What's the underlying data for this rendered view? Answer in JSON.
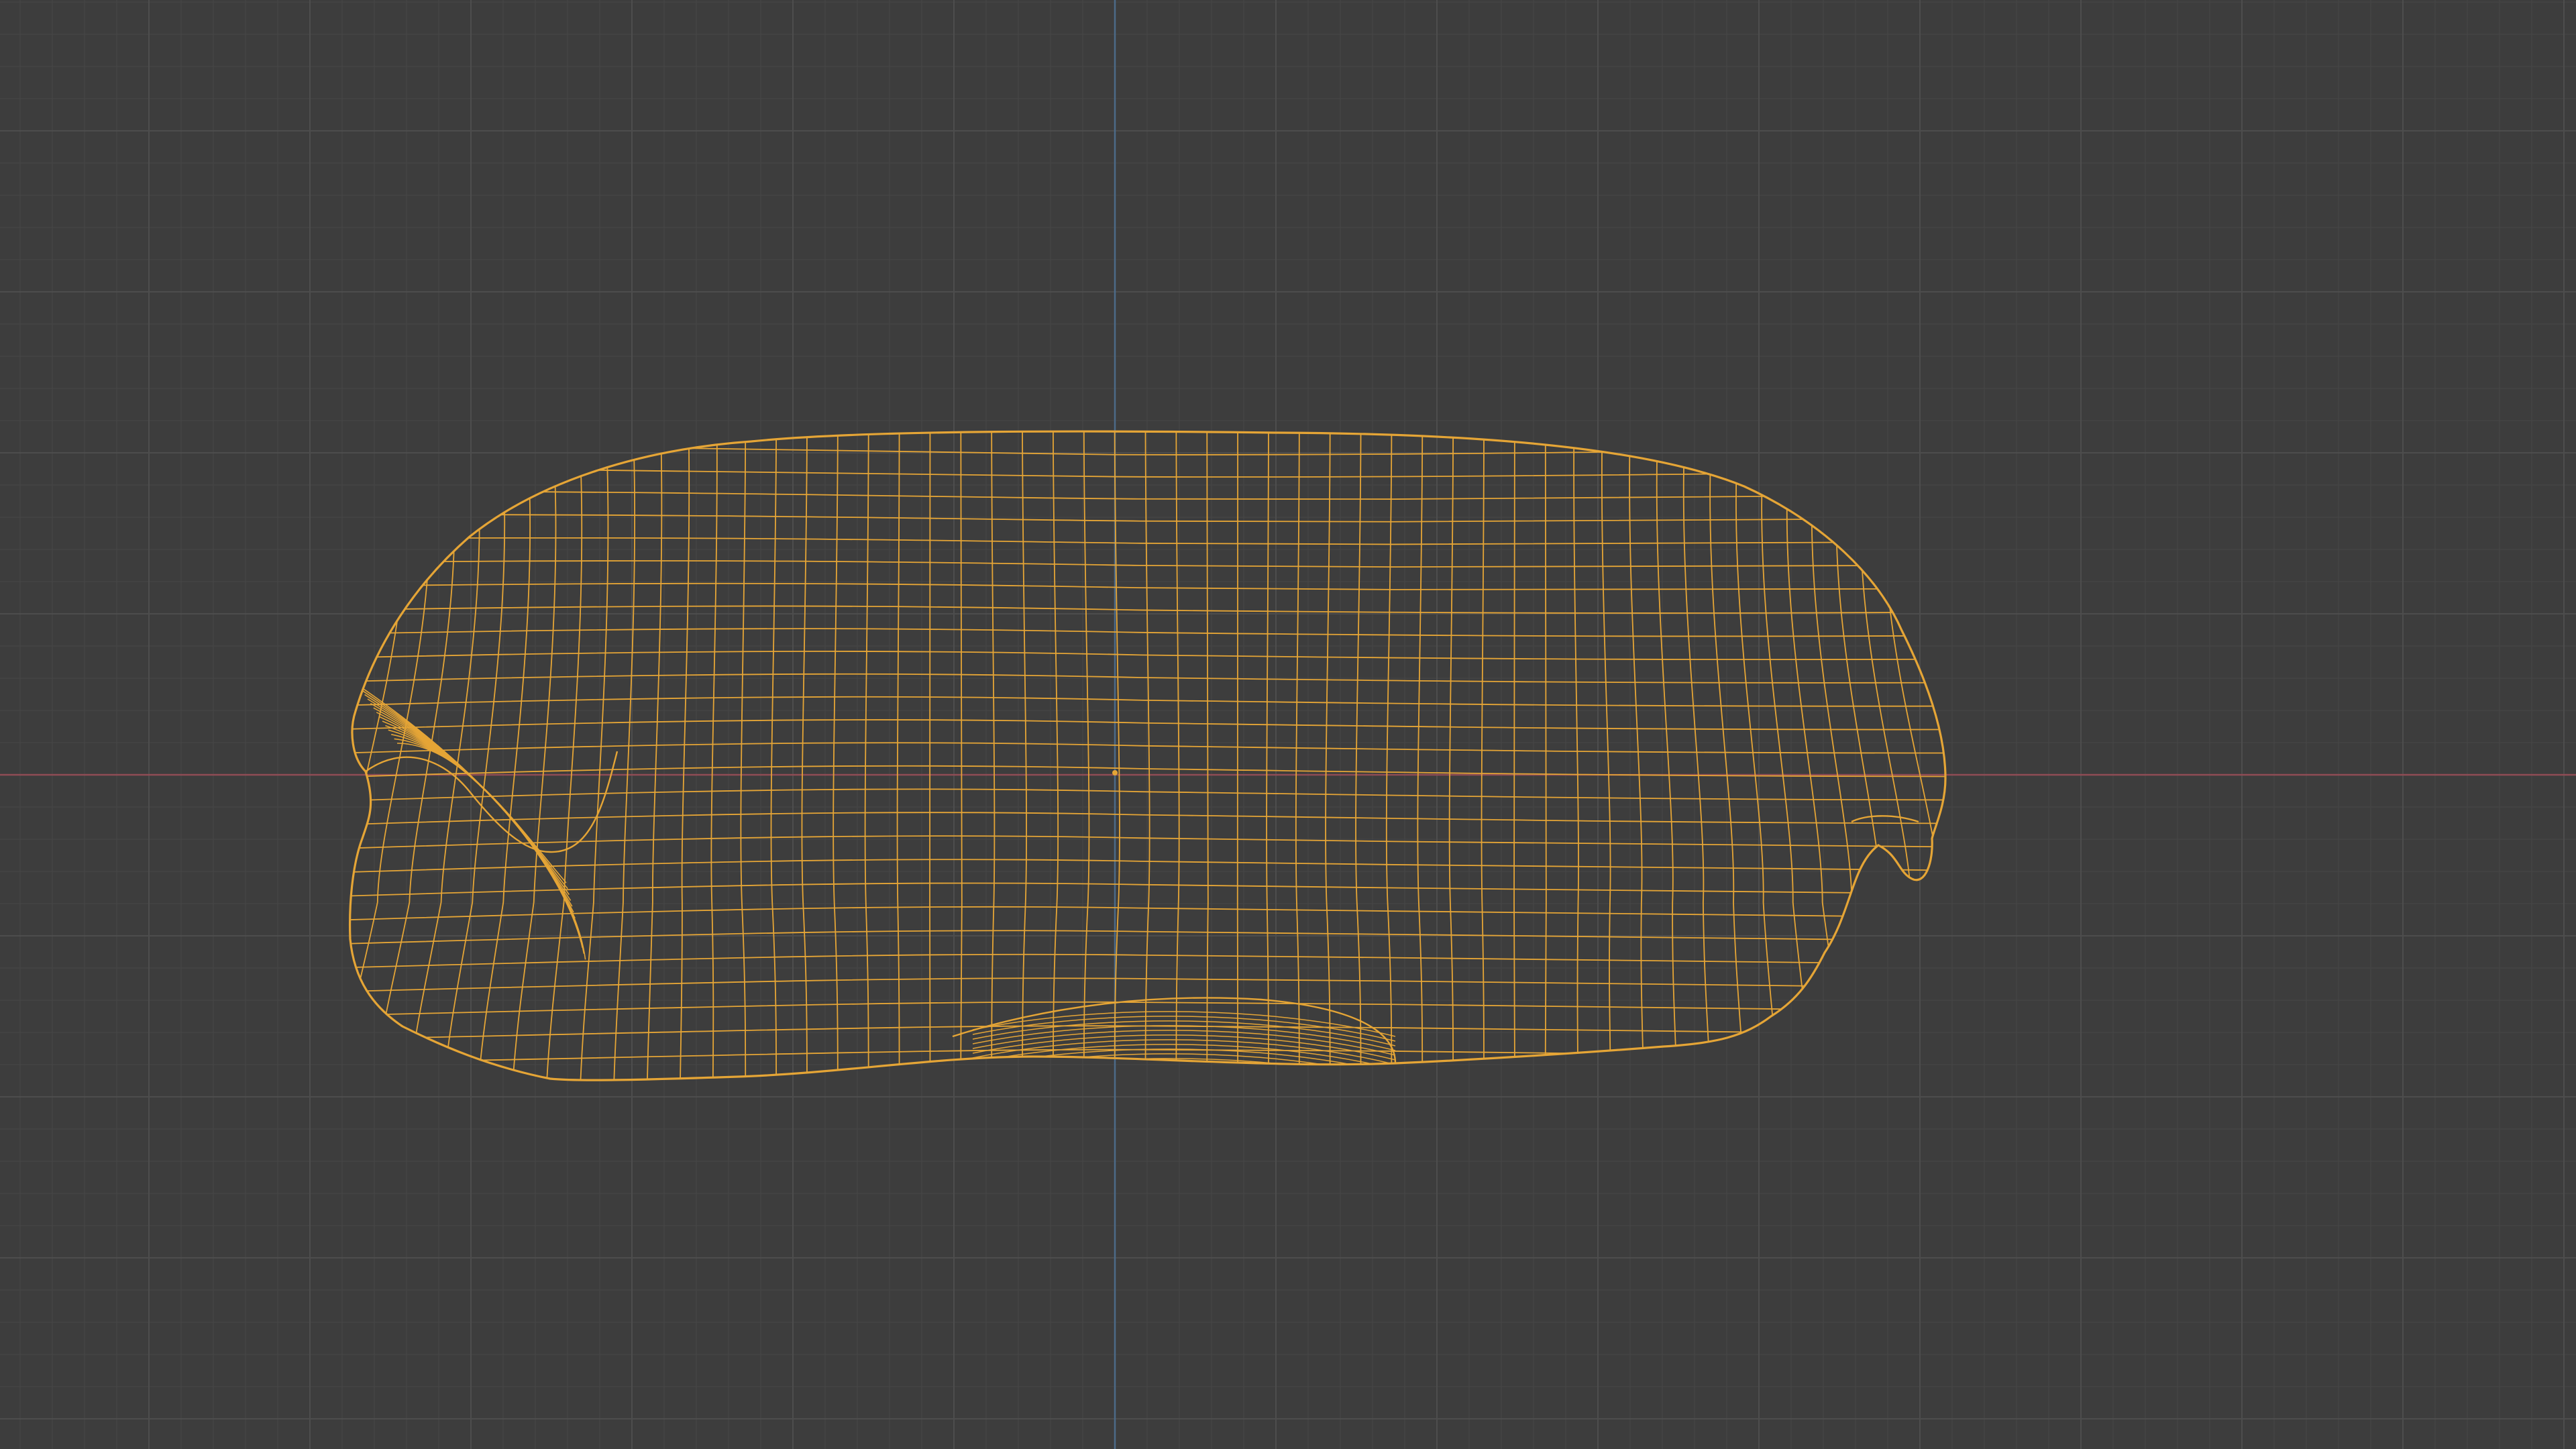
{
  "viewport": {
    "kind": "3d-viewport-wireframe",
    "background_color": "#3d3d3d",
    "grid": {
      "visible": true,
      "minor_color": "#454545",
      "major_color": "#4d4d4d"
    },
    "axes": {
      "x_axis_color": "#8f4c55",
      "z_axis_color": "#4c6a87"
    },
    "mesh": {
      "display": "wireframe",
      "selected": true,
      "wire_color": "#e5a536",
      "origin_marker_color": "#e5a536"
    }
  }
}
